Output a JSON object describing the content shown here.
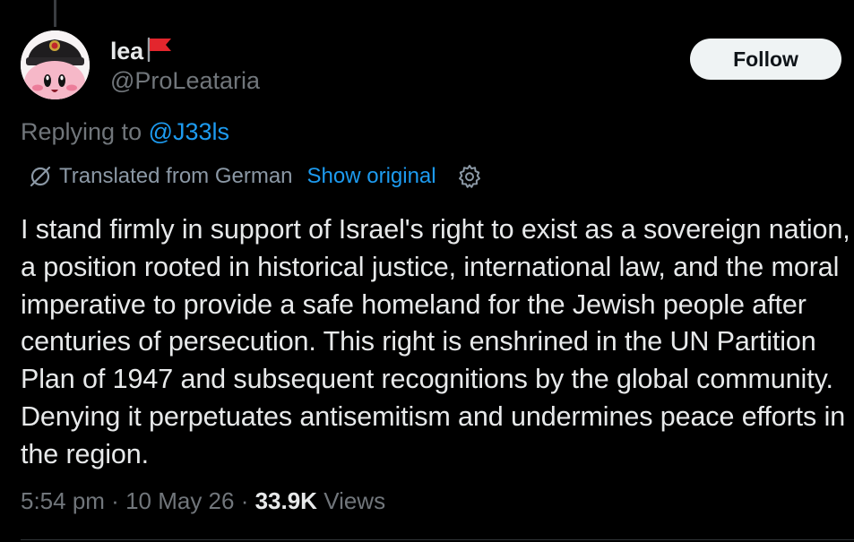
{
  "author": {
    "display_name": "lea",
    "handle": "@ProLeataria",
    "name_emoji_icon": "red-flag-icon",
    "avatar_icon": "kirby-with-soviet-hat-avatar"
  },
  "follow_button": {
    "label": "Follow"
  },
  "reply_context": {
    "prefix": "Replying to ",
    "mention": "@J33ls"
  },
  "translation": {
    "icon": "translate-icon",
    "label": "Translated from German",
    "show_original": "Show original",
    "settings_icon": "gear-icon"
  },
  "tweet": {
    "text": "I stand firmly in support of Israel's right to exist as a sovereign nation, a position rooted in historical justice, international law, and the moral imperative to provide a safe homeland for the Jewish people after centuries of persecution. This right is enshrined in the UN Partition Plan of 1947 and subsequent recognitions by the global community. Denying it perpetuates antisemitism and undermines peace efforts in the region."
  },
  "meta": {
    "time": "5:54 pm",
    "separator": " · ",
    "date": "10 May 26",
    "views_count": "33.9K",
    "views_label": " Views"
  },
  "colors": {
    "background": "#000000",
    "primary_text": "#e7e9ea",
    "secondary_text": "#71767b",
    "accent": "#1d9bf0",
    "follow_button_bg": "#eff3f4"
  }
}
